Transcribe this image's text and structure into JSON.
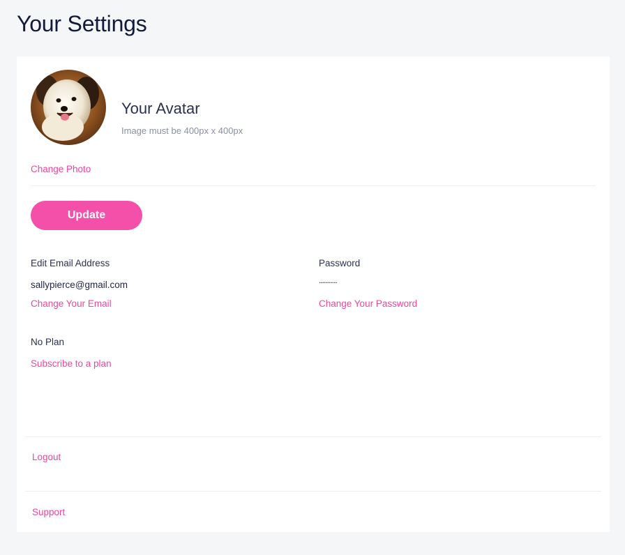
{
  "page": {
    "title": "Your Settings"
  },
  "avatar": {
    "title": "Your Avatar",
    "hint": "Image must be 400px x 400px",
    "change_label": "Change Photo",
    "image_icon": "dog-photo"
  },
  "update_label": "Update",
  "email": {
    "label": "Edit Email Address",
    "value": "sallypierce@gmail.com",
    "change_label": "Change Your Email"
  },
  "password": {
    "label": "Password",
    "value": "...........",
    "change_label": "Change Your Password"
  },
  "plan": {
    "status": "No Plan",
    "subscribe_label": "Subscribe to a plan"
  },
  "footer": {
    "logout_label": "Logout",
    "support_label": "Support"
  },
  "colors": {
    "accent": "#f2449f",
    "button": "#f44fa9",
    "background": "#f4f6f8",
    "title": "#141a3a"
  }
}
